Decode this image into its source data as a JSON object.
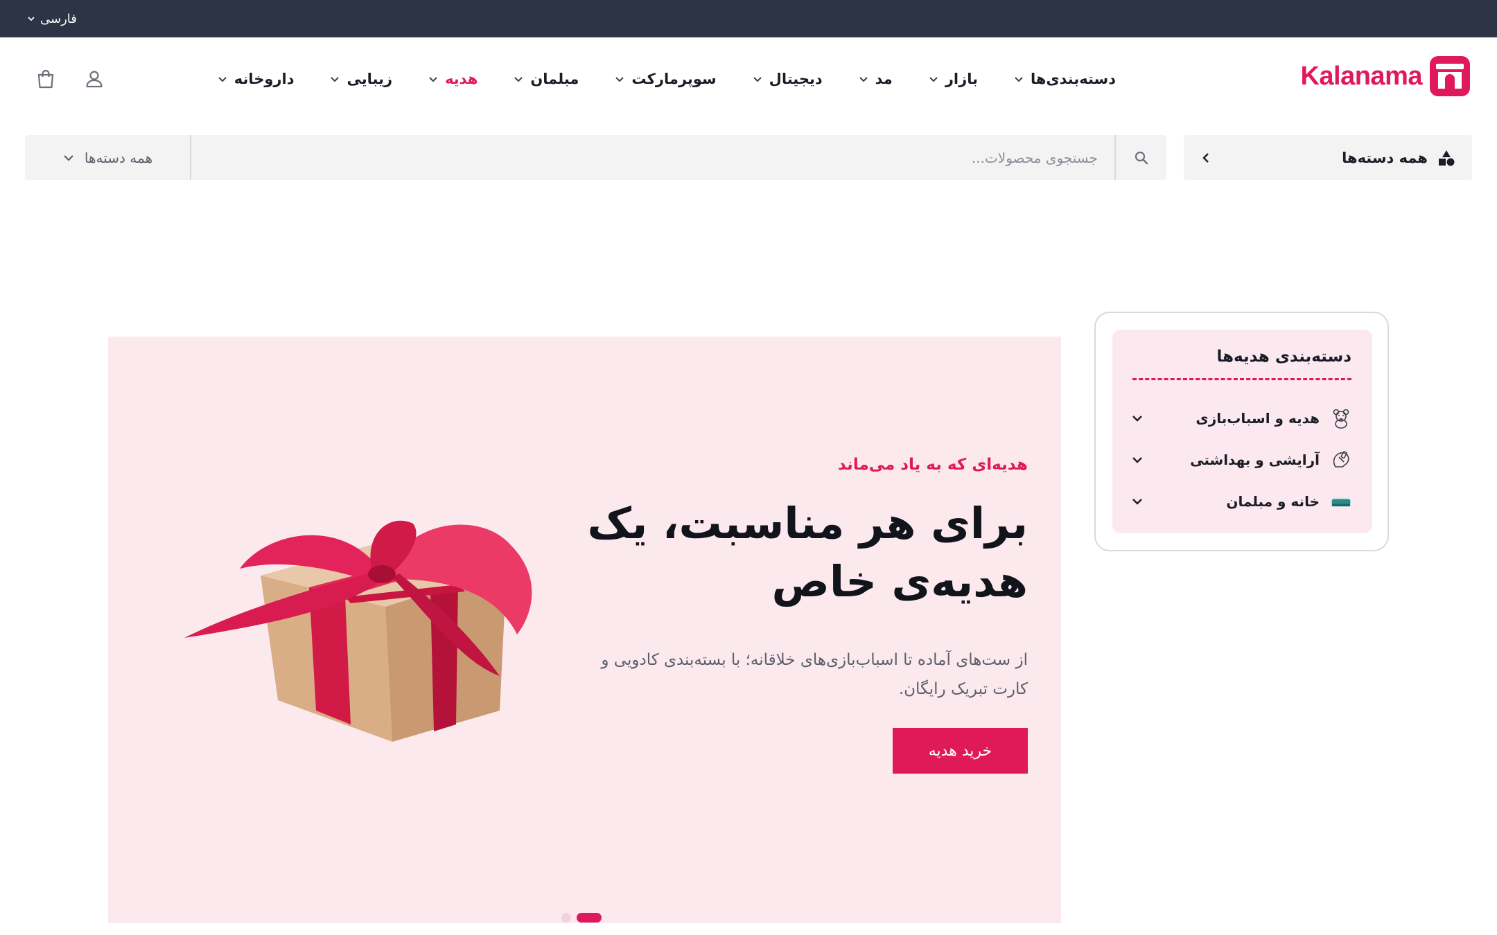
{
  "topbar": {
    "language": "فارسی"
  },
  "header": {
    "logo_text": "Kalanama",
    "nav": [
      {
        "label": "دسته‌بندی‌ها",
        "active": false
      },
      {
        "label": "بازار",
        "active": false
      },
      {
        "label": "مد",
        "active": false
      },
      {
        "label": "دیجیتال",
        "active": false
      },
      {
        "label": "سوپرمارکت",
        "active": false
      },
      {
        "label": "مبلمان",
        "active": false
      },
      {
        "label": "هدیه",
        "active": true
      },
      {
        "label": "زیبایی",
        "active": false
      },
      {
        "label": "داروخانه",
        "active": false
      }
    ],
    "icons": [
      "shopping-bag-icon",
      "user-icon"
    ]
  },
  "search": {
    "all_categories_button": "همه دسته‌ها",
    "placeholder": "جستجوی محصولات...",
    "category_select": "همه دسته‌ها"
  },
  "sidebar": {
    "title": "دسته‌بندی هدیه‌ها",
    "items": [
      {
        "label": "هدیه و اسباب‌بازی",
        "icon": "teddy-bear-icon"
      },
      {
        "label": "آرایشی و بهداشتی",
        "icon": "cosmetics-hand-icon"
      },
      {
        "label": "خانه و مبلمان",
        "icon": "sofa-icon"
      }
    ]
  },
  "hero": {
    "subtitle": "هدیه‌ای که به یاد می‌ماند",
    "title": "برای هر مناسبت، یک هدیه‌ی خاص",
    "description": "از ست‌های آماده تا اسباب‌بازی‌های خلاقانه؛ با بسته‌بندی کادویی و کارت تبریک رایگان.",
    "button": "خرید هدیه",
    "image": "gift-box-with-red-ribbon",
    "slides": 2,
    "active_slide": 2
  },
  "colors": {
    "brand": "#e0195a",
    "topbar": "#2d3446",
    "hero_bg": "#fce9ee",
    "sidebar_bg": "#fce9ef",
    "search_bg": "#f3f3f4"
  }
}
